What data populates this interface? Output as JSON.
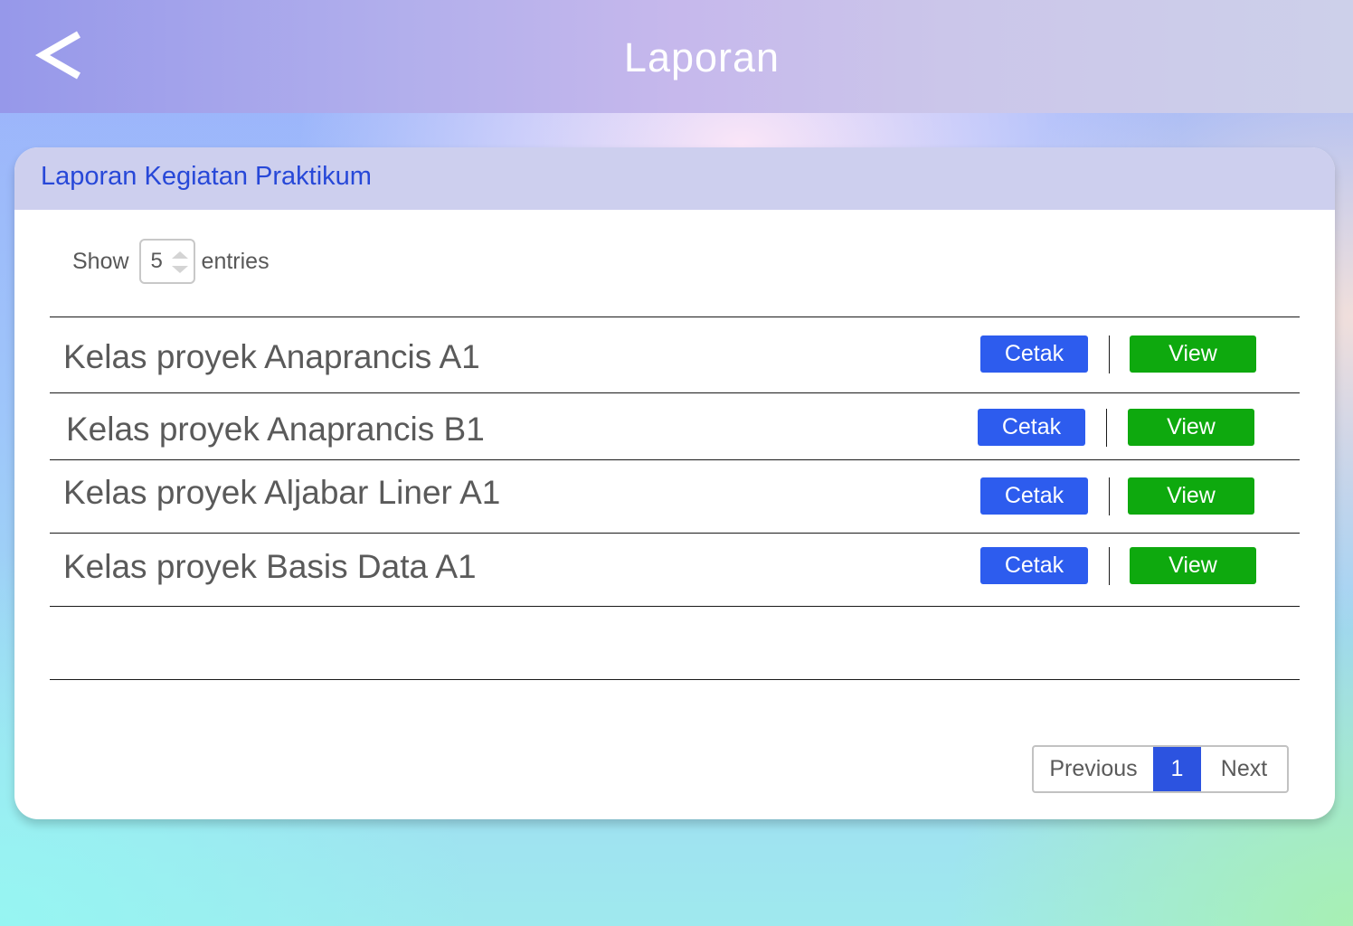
{
  "header": {
    "title": "Laporan",
    "back_icon": "chevron-left-icon"
  },
  "card": {
    "title": "Laporan Kegiatan Praktikum"
  },
  "show_entries": {
    "show_label": "Show",
    "value": "5",
    "entries_label": "entries"
  },
  "rows": [
    {
      "label": "Kelas proyek Anaprancis A1",
      "print_label": "Cetak",
      "view_label": "View"
    },
    {
      "label": "Kelas proyek Anaprancis B1",
      "print_label": "Cetak",
      "view_label": "View"
    },
    {
      "label": "Kelas proyek Aljabar Liner A1",
      "print_label": "Cetak",
      "view_label": "View"
    },
    {
      "label": "Kelas proyek Basis Data A1",
      "print_label": "Cetak",
      "view_label": "View"
    }
  ],
  "pagination": {
    "previous_label": "Previous",
    "current_page": "1",
    "next_label": "Next"
  },
  "colors": {
    "print_button": "#2d5cee",
    "view_button": "#0ea90e",
    "active_page": "#2c53e0",
    "card_title": "#2748d8"
  }
}
